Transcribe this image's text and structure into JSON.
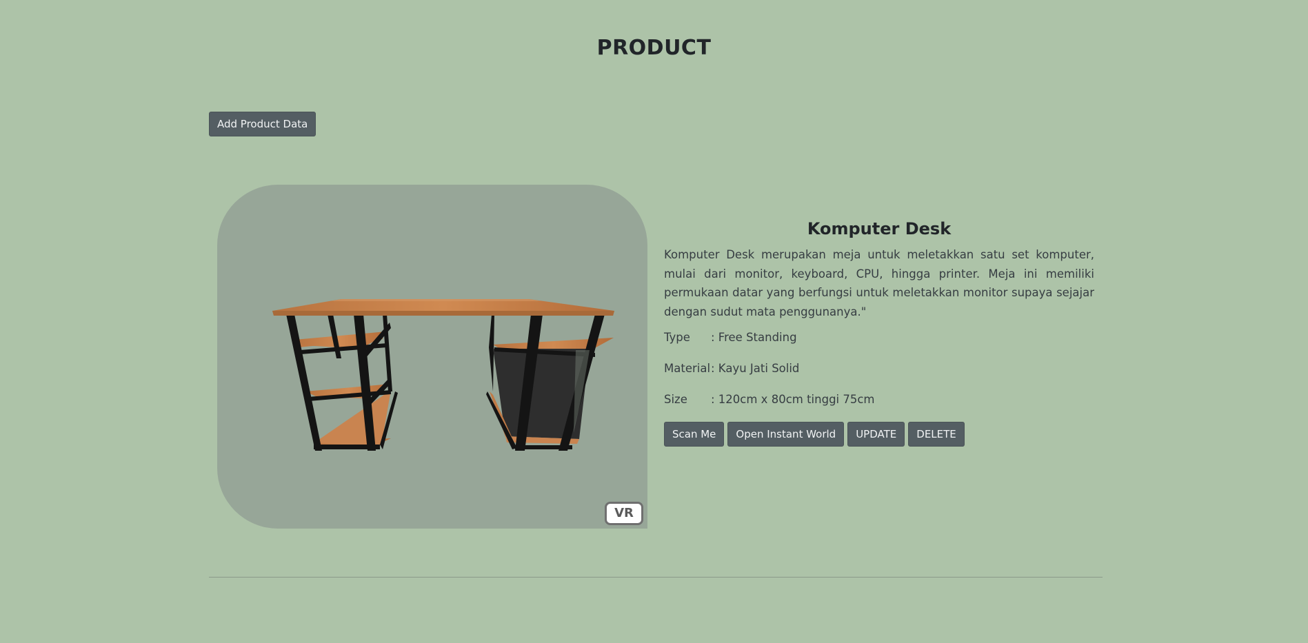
{
  "header": {
    "title": "PRODUCT"
  },
  "toolbar": {
    "add_label": "Add Product Data"
  },
  "viewer": {
    "vr_label": "VR"
  },
  "product": {
    "name": "Komputer Desk",
    "description": "Komputer Desk merupakan meja untuk meletakkan satu set komputer, mulai dari monitor, keyboard, CPU, hingga printer. Meja ini memiliki permukaan datar yang berfungsi untuk meletakkan monitor supaya sejajar dengan sudut mata penggunanya.\"",
    "specs": [
      {
        "label": "Type",
        "value": ": Free Standing"
      },
      {
        "label": "Material",
        "value": ": Kayu Jati Solid"
      },
      {
        "label": "Size",
        "value": ": 120cm x 80cm tinggi 75cm"
      }
    ],
    "actions": {
      "scan_label": "Scan Me",
      "instant_world_label": "Open Instant World",
      "update_label": "UPDATE",
      "delete_label": "DELETE"
    }
  },
  "colors": {
    "page_background": "#adc3a8",
    "viewer_background": "#97a698",
    "button_background": "#545e63",
    "wood": "#c8804a",
    "frame": "#141414"
  },
  "icons": {
    "desk_model": "3d-desk-model"
  }
}
